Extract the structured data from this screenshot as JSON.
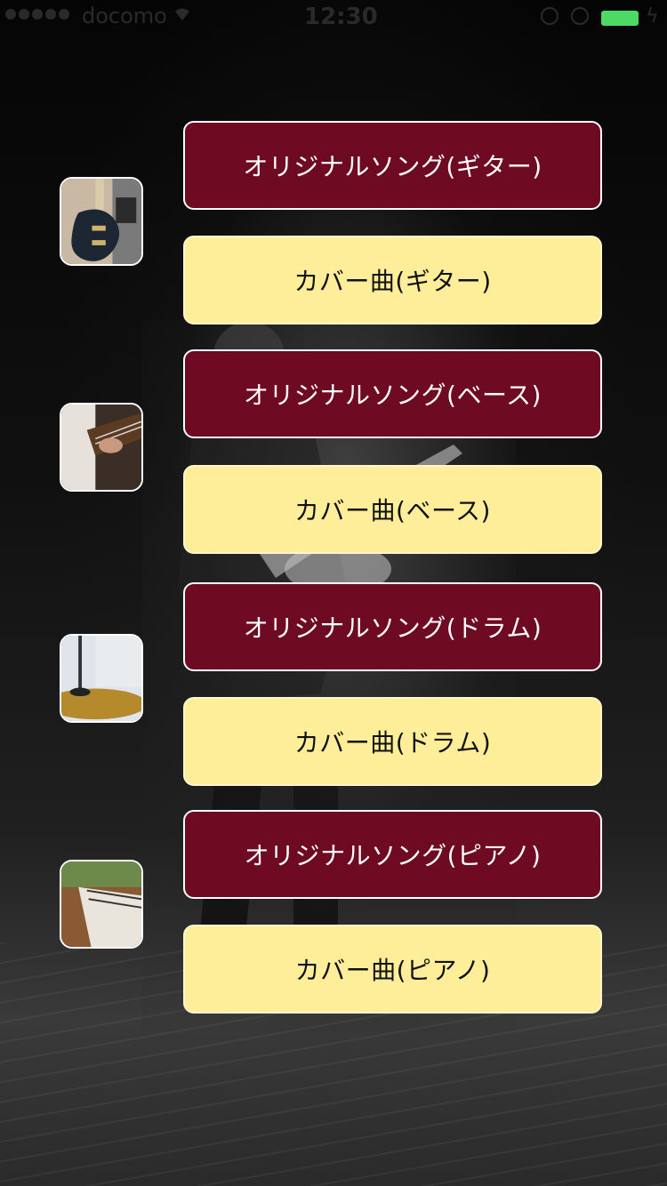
{
  "status_bar": {
    "carrier": "docomo",
    "time": "12:30",
    "battery_color": "#4cd964",
    "icons": [
      "wifi-icon",
      "orientation-lock-icon",
      "alarm-icon",
      "battery-icon",
      "charging-bolt-icon"
    ]
  },
  "background": {
    "image": "live-concert-guitarist-photo"
  },
  "colors": {
    "original": "#6e0b22",
    "cover": "#ffee99"
  },
  "rows": [
    {
      "instrument": "guitar",
      "thumbnail_icon": "electric-guitar-photo",
      "original_label": "オリジナルソング(ギター)",
      "cover_label": "カバー曲(ギター)"
    },
    {
      "instrument": "bass",
      "thumbnail_icon": "bass-guitar-photo",
      "original_label": "オリジナルソング(ベース)",
      "cover_label": "カバー曲(ベース)"
    },
    {
      "instrument": "drum",
      "thumbnail_icon": "cymbal-photo",
      "original_label": "オリジナルソング(ドラム)",
      "cover_label": "カバー曲(ドラム)"
    },
    {
      "instrument": "piano",
      "thumbnail_icon": "piano-keys-photo",
      "original_label": "オリジナルソング(ピアノ)",
      "cover_label": "カバー曲(ピアノ)"
    }
  ]
}
